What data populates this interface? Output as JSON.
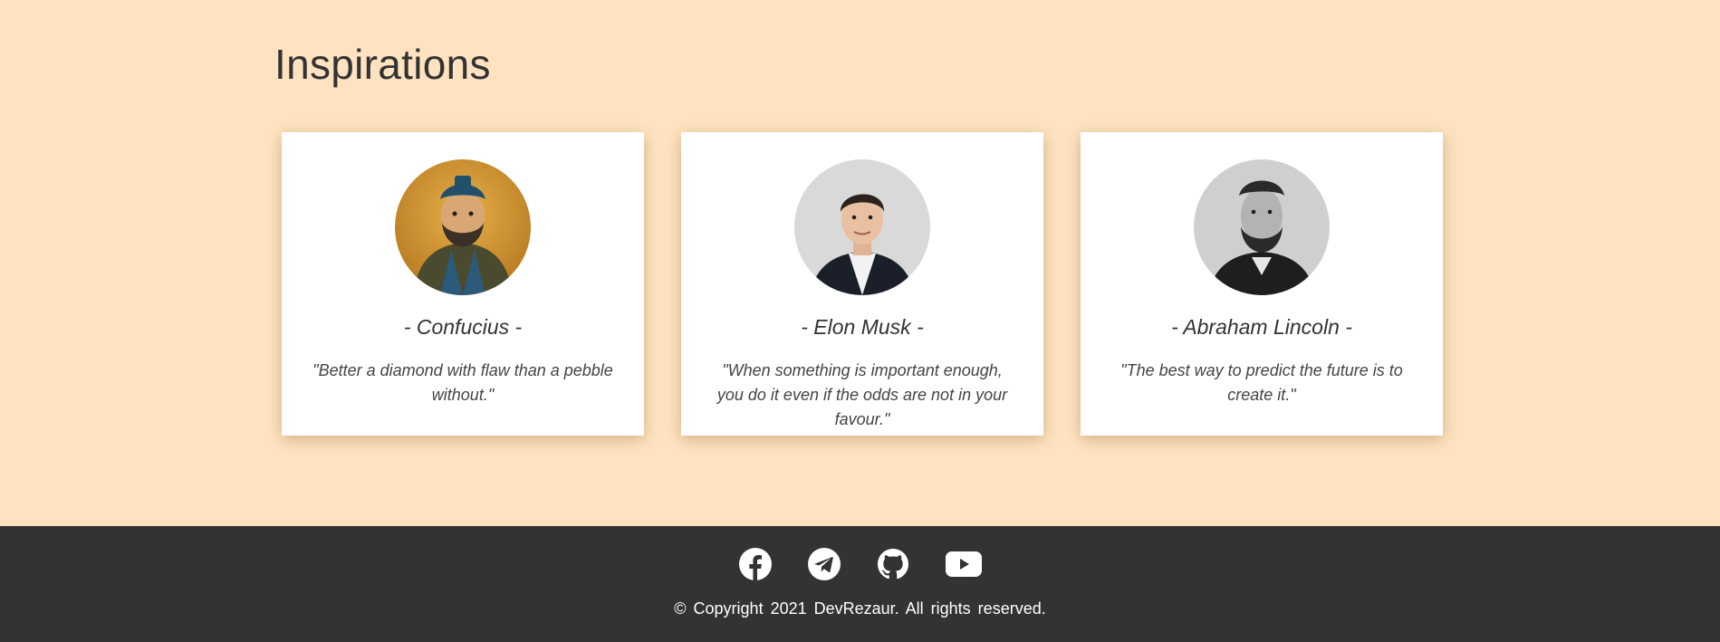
{
  "section": {
    "title": "Inspirations"
  },
  "cards": [
    {
      "name": "- Confucius -",
      "quote": "\"Better a diamond with flaw than a pebble without.\"",
      "avatar_icon": "confucius-portrait"
    },
    {
      "name": "- Elon Musk -",
      "quote": "\"When something is important enough, you do it even if the odds are not in your favour.\"",
      "avatar_icon": "elon-musk-portrait"
    },
    {
      "name": "- Abraham Lincoln -",
      "quote": "\"The best way to predict the future is to create it.\"",
      "avatar_icon": "abraham-lincoln-portrait"
    }
  ],
  "footer": {
    "social_icons": [
      "facebook-icon",
      "telegram-icon",
      "github-icon",
      "youtube-icon"
    ],
    "copyright": "© Copyright 2021 DevRezaur. All rights reserved."
  },
  "colors": {
    "page_background": "#ffe3c0",
    "card_background": "#ffffff",
    "footer_background": "#333333",
    "text": "#333333",
    "footer_text": "#ffffff"
  }
}
